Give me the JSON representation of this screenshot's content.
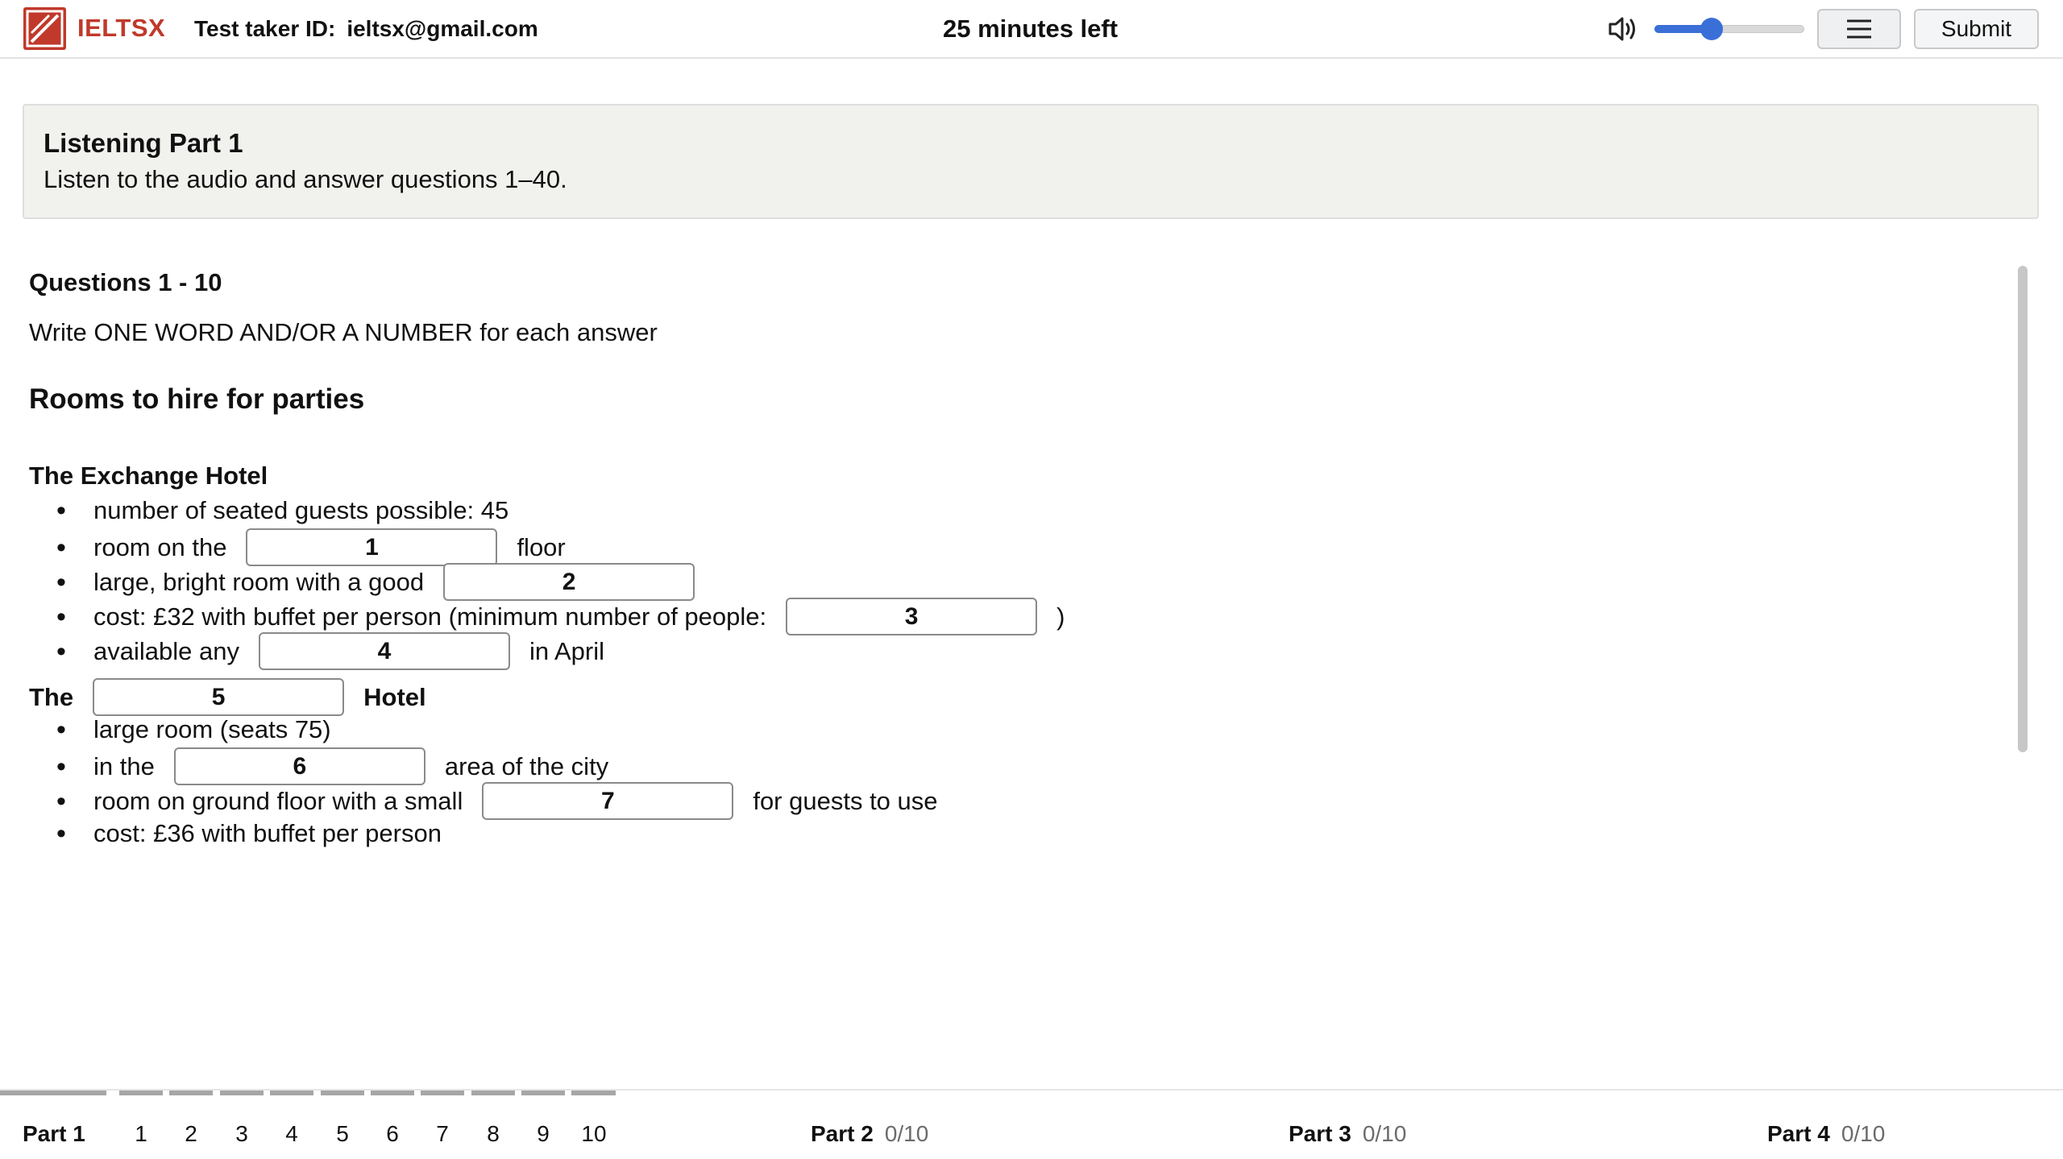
{
  "header": {
    "brand": "IELTSX",
    "taker_label": "Test taker ID:",
    "taker_id": "ieltsx@gmail.com",
    "timer": "25 minutes left",
    "volume_level": 0.38,
    "submit_label": "Submit",
    "icons": {
      "logo": "ieltsx-logo-icon",
      "volume": "speaker-volume-icon",
      "menu": "hamburger-menu-icon"
    },
    "colors": {
      "brand": "#c0392b",
      "slider": "#3a6fd8"
    }
  },
  "banner": {
    "title": "Listening Part 1",
    "text": "Listen to the audio and answer questions 1–40."
  },
  "questions": {
    "title": "Questions 1 - 10",
    "instruction": "Write ONE WORD AND/OR A NUMBER for each answer",
    "form_title": "Rooms to hire for parties",
    "section1": {
      "title": "The Exchange Hotel"
    },
    "rows": {
      "r1": {
        "text": "number of seated guests possible: 45"
      },
      "r2": {
        "before": "room on the",
        "blank": "1",
        "after": "floor"
      },
      "r3": {
        "before": "large, bright room with a good",
        "blank": "2",
        "after": ""
      },
      "r4": {
        "before": "cost: £32 with buffet per person (minimum number of people:",
        "blank": "3",
        "after": ")"
      },
      "r5": {
        "before": "available any",
        "blank": "4",
        "after": "in April"
      },
      "r7": {
        "text": "large room (seats 75)"
      },
      "r8": {
        "before": "in the",
        "blank": "6",
        "after": "area of the city"
      },
      "r9": {
        "before": "room on ground floor with a small",
        "blank": "7",
        "after": "for guests to use"
      },
      "r10": {
        "text": "cost: £36 with buffet per person"
      }
    },
    "section2": {
      "before": "The",
      "blank": "5",
      "after": "Hotel"
    }
  },
  "footer": {
    "part1": {
      "name": "Part 1",
      "numbers": [
        "1",
        "2",
        "3",
        "4",
        "5",
        "6",
        "7",
        "8",
        "9",
        "10"
      ]
    },
    "part2": {
      "name": "Part 2",
      "count": "0/10"
    },
    "part3": {
      "name": "Part 3",
      "count": "0/10"
    },
    "part4": {
      "name": "Part 4",
      "count": "0/10"
    }
  }
}
